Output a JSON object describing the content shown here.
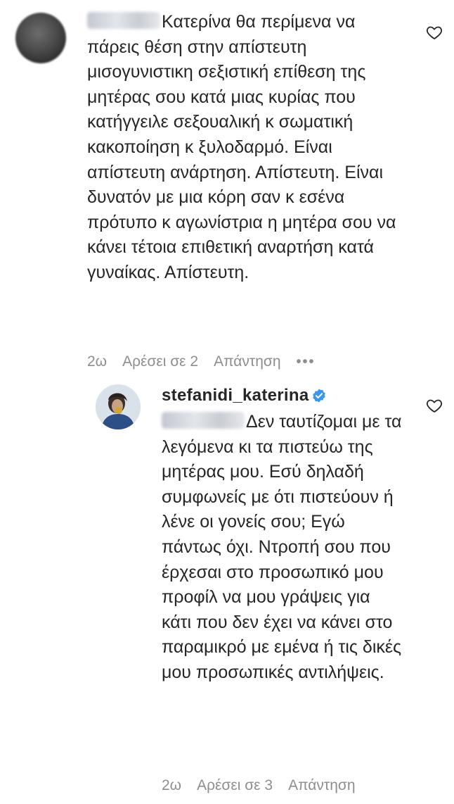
{
  "comment": {
    "avatar_icon": "blurred-avatar",
    "username_visible": "",
    "text": "Κατερίνα θα περίμενα να πάρεις θέση στην απίστευτη μισογυνιστικη σεξιστική επίθεση της μητέρας σου κατά μιας κυρίας που κατήγγειλε σεξουαλική κ σωματική κακοποίηση κ ξυλοδαρμό. Είναι απίστευτη ανάρτηση. Απίστευτη. Είναι δυνατόν με μια κόρη σαν κ εσένα πρότυπο κ αγωνίστρια η μητέρα σου να κάνει τέτοια επιθετική αναρτήση κατά γυναίκας. Απίστευτη.",
    "time": "2ω",
    "likes": "Αρέσει σε 2",
    "reply_label": "Απάντηση",
    "more_label": "•••"
  },
  "reply": {
    "username": "stefanidi_katerina",
    "verified": true,
    "text": "Δεν ταυτίζομαι με τα λεγόμενα κι τα πιστεύω της μητέρας μου. Εσύ δηλαδή συμφωνείς με ότι πιστεύουν ή λένε οι γονείς σου; Εγώ πάντως όχι. Ντροπή σου που έρχεσαι στο προσωπικό μου προφίλ να μου γράψεις για κάτι που δεν έχει να κάνει στο παραμικρό με εμένα ή τις δικές μου προσωπικές αντιλήψεις.",
    "time": "2ω",
    "likes": "Αρέσει σε 3",
    "reply_label": "Απάντηση"
  },
  "colors": {
    "text": "#262626",
    "meta": "#8e8e8e",
    "verified": "#3897f0"
  }
}
